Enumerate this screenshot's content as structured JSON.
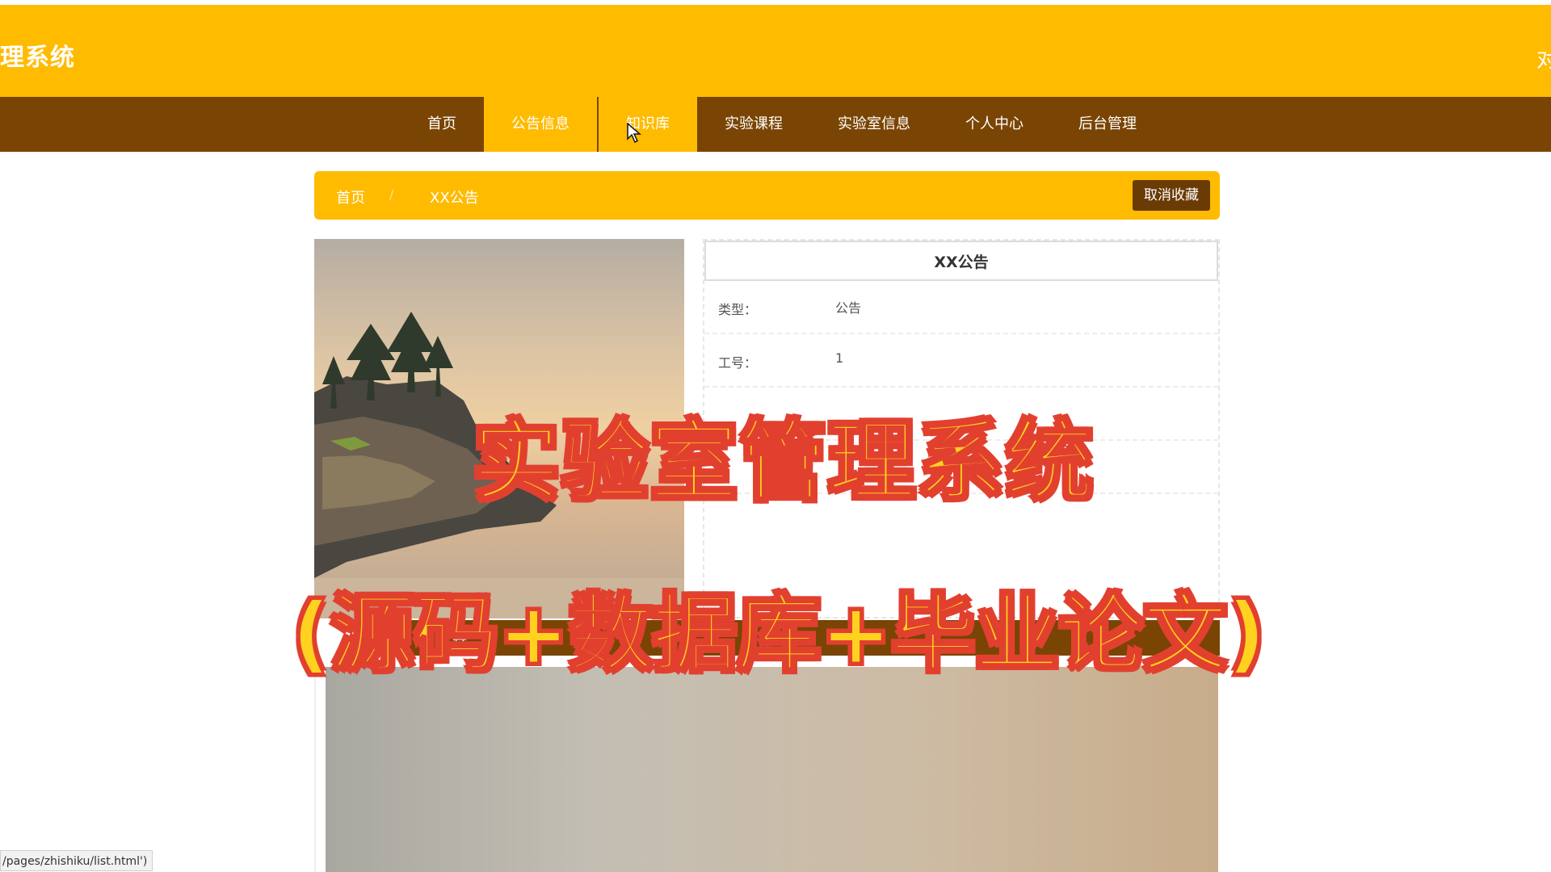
{
  "header": {
    "site_title": "理系统",
    "user_fragment": "对"
  },
  "nav": {
    "items": [
      {
        "label": "首页"
      },
      {
        "label": "公告信息"
      },
      {
        "label": "知识库"
      },
      {
        "label": "实验课程"
      },
      {
        "label": "实验室信息"
      },
      {
        "label": "个人中心"
      },
      {
        "label": "后台管理"
      }
    ]
  },
  "breadcrumb": {
    "home": "首页",
    "separator": "/",
    "current": "XX公告",
    "action": "取消收藏"
  },
  "detail": {
    "title": "XX公告",
    "rows": [
      {
        "key": "类型：",
        "value": "公告"
      },
      {
        "key": "工号：",
        "value": "1"
      },
      {
        "key": "",
        "value": ""
      },
      {
        "key": "",
        "value": ""
      }
    ]
  },
  "content_section": {
    "label": "容"
  },
  "status_bar": {
    "url": "/pages/zhishiku/list.html')"
  },
  "overlay": {
    "line1": "实验室管理系统",
    "line2": "(源码+数据库+毕业论文)"
  },
  "colors": {
    "brand_yellow": "#FFBB00",
    "nav_brown": "#7A4504",
    "overlay_fill": "#FFD21F",
    "overlay_stroke": "#E2402F"
  },
  "icons": {
    "cursor": "mouse-pointer-icon"
  }
}
